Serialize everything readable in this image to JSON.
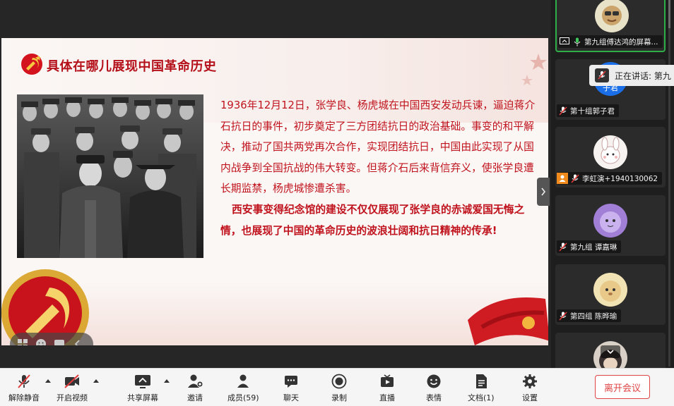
{
  "slide": {
    "title": "具体在哪儿展现中国革命历史",
    "paragraph1": "1936年12月12日，张学良、杨虎城在中国西安发动兵谏，逼迫蒋介石抗日的事件，初步奠定了三方团结抗日的政治基础。事变的和平解决，推动了国共两党再次合作，实现团结抗日，中国由此实现了从国内战争到全国抗战的伟大转变。但蒋介石后来背信弃义，使张学良遭长期监禁，杨虎城惨遭杀害。",
    "paragraph2": "西安事变得纪念馆的建设不仅仅展现了张学良的赤诚爱国无悔之情，也展现了中国的革命历史的波浪壮阔和抗日精神的传承!",
    "accent_color": "#b5111b"
  },
  "participants": [
    {
      "caption": "第九组傅达鸿的屏幕...",
      "mic": "on",
      "sharing": true,
      "active": true
    },
    {
      "caption": "第十组郭子君",
      "mic": "muted",
      "avatar_text": "子君"
    },
    {
      "caption": "李虹演+1940130062",
      "mic": "muted",
      "has_person_badge": true
    },
    {
      "caption": "第九组 谭嘉琳",
      "mic": "muted"
    },
    {
      "caption": "第四组 陈晔瑜",
      "mic": "muted"
    },
    {
      "caption": "",
      "mic": "muted"
    }
  ],
  "speaking_toast": {
    "text": "正在讲话: 第九"
  },
  "toolbar": {
    "unmute": "解除静音",
    "start_video": "开启视频",
    "share_screen": "共享屏幕",
    "invite": "邀请",
    "members": "成员(59)",
    "chat": "聊天",
    "record": "录制",
    "live": "直播",
    "reactions": "表情",
    "documents": "文档(1)",
    "settings": "设置",
    "leave": "离开会议",
    "leave_color": "#e04545"
  },
  "icons": [
    "mic-muted-icon",
    "video-off-icon",
    "share-screen-icon",
    "invite-icon",
    "members-icon",
    "chat-icon",
    "record-icon",
    "live-icon",
    "reactions-icon",
    "documents-icon",
    "settings-icon"
  ]
}
